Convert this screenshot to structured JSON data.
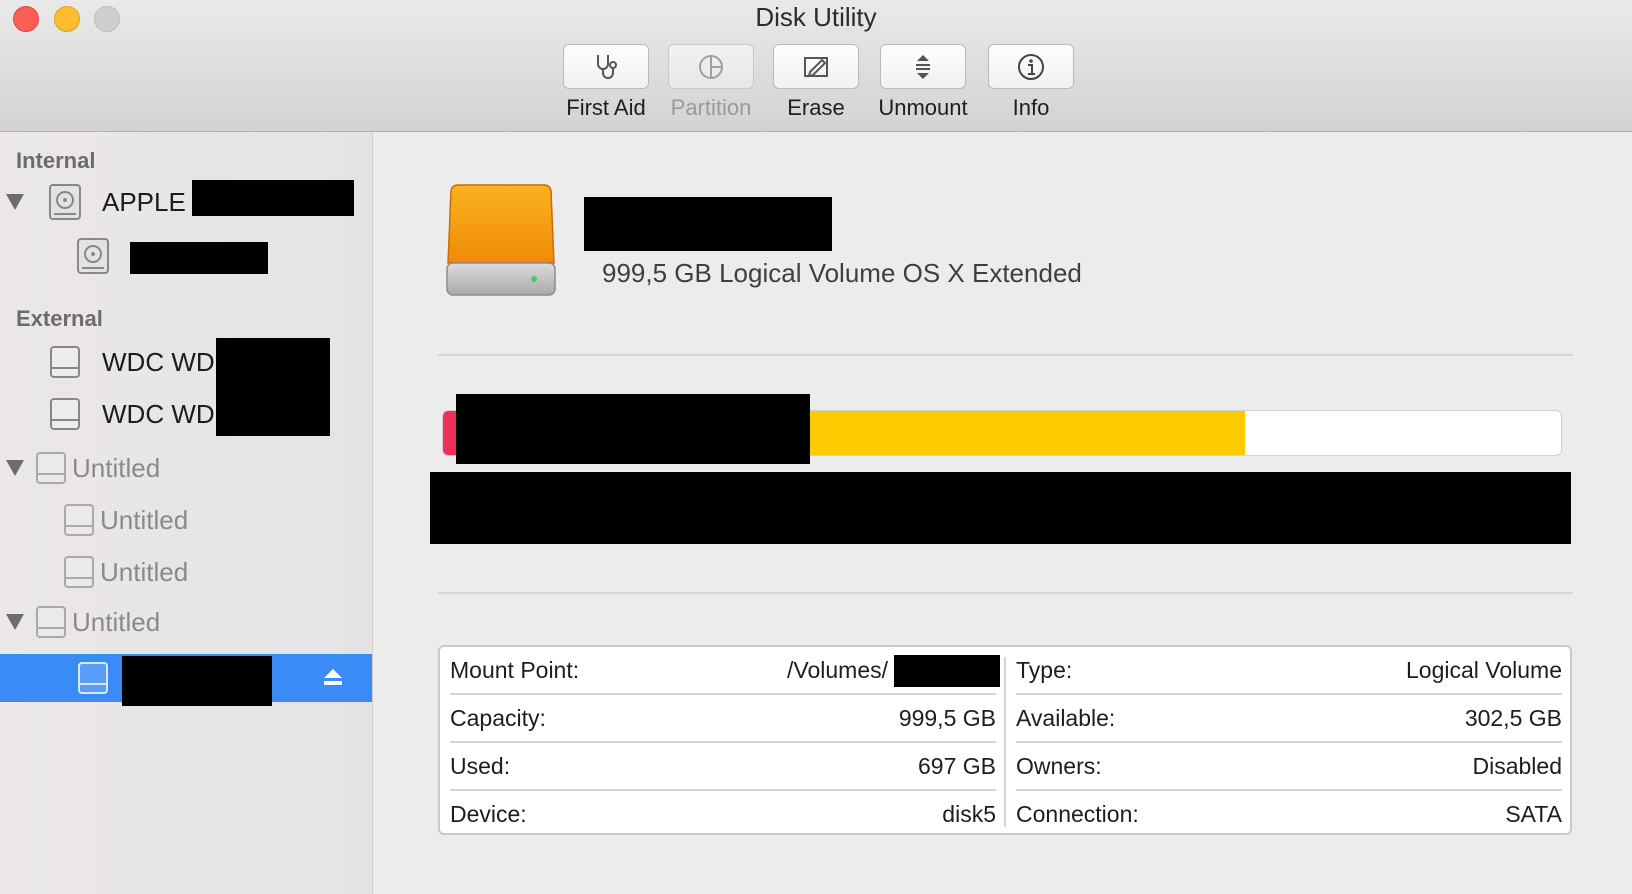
{
  "window": {
    "title": "Disk Utility"
  },
  "toolbar": {
    "first_aid": "First Aid",
    "partition": "Partition",
    "erase": "Erase",
    "unmount": "Unmount",
    "info": "Info"
  },
  "sidebar": {
    "internal_header": "Internal",
    "external_header": "External",
    "items": [
      {
        "label": "APPLE",
        "level": 0,
        "expanded": true
      },
      {
        "label": "",
        "level": 1
      },
      {
        "label": "WDC WD",
        "level": 0
      },
      {
        "label": "WDC WD",
        "level": 0
      },
      {
        "label": "Untitled",
        "level": 0,
        "expanded": true
      },
      {
        "label": "Untitled",
        "level": 1
      },
      {
        "label": "Untitled",
        "level": 1
      },
      {
        "label": "Untitled",
        "level": 0,
        "expanded": true
      },
      {
        "label": "",
        "level": 1,
        "selected": true
      }
    ]
  },
  "volume": {
    "name": "",
    "subtitle": "999,5 GB Logical Volume OS X Extended"
  },
  "usage": {
    "other_fraction": 0.017,
    "used_fraction": 0.7,
    "colors": {
      "other": "#ee2e5b",
      "used": "#fecb02",
      "free": "#ffffff"
    }
  },
  "info": {
    "left": [
      {
        "key": "Mount Point:",
        "value": "/Volumes/"
      },
      {
        "key": "Capacity:",
        "value": "999,5 GB"
      },
      {
        "key": "Used:",
        "value": "697 GB"
      },
      {
        "key": "Device:",
        "value": "disk5"
      }
    ],
    "right": [
      {
        "key": "Type:",
        "value": "Logical Volume"
      },
      {
        "key": "Available:",
        "value": "302,5 GB"
      },
      {
        "key": "Owners:",
        "value": "Disabled"
      },
      {
        "key": "Connection:",
        "value": "SATA"
      }
    ]
  },
  "icons": {
    "first_aid": "stethoscope-icon",
    "partition": "pie-icon",
    "erase": "pencil-icon",
    "unmount": "unmount-icon",
    "info": "info-icon",
    "eject": "eject-icon"
  }
}
